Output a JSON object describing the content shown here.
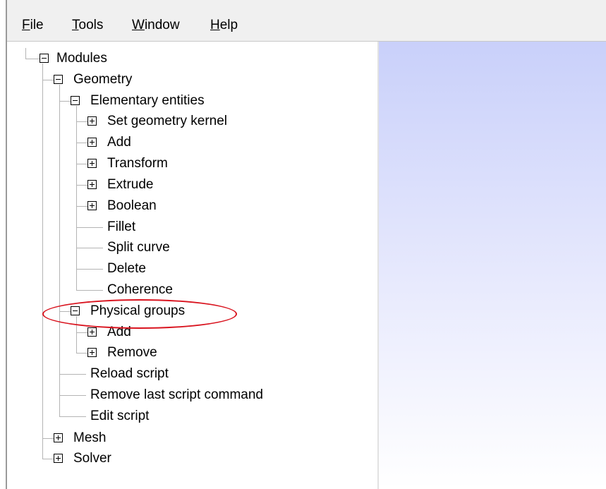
{
  "menubar": {
    "file": {
      "mnemonic": "F",
      "rest": "ile"
    },
    "tools": {
      "mnemonic": "T",
      "rest": "ools"
    },
    "window": {
      "mnemonic": "W",
      "rest": "indow"
    },
    "help": {
      "mnemonic": "H",
      "rest": "elp"
    }
  },
  "tree": {
    "modules": "Modules",
    "geometry": "Geometry",
    "elementary_entities": "Elementary entities",
    "set_geometry_kernel": "Set geometry kernel",
    "add": "Add",
    "transform": "Transform",
    "extrude": "Extrude",
    "boolean": "Boolean",
    "fillet": "Fillet",
    "split_curve": "Split curve",
    "delete": "Delete",
    "coherence": "Coherence",
    "physical_groups": "Physical groups",
    "physical_add": "Add",
    "physical_remove": "Remove",
    "reload_script": "Reload script",
    "remove_last_script_command": "Remove last script command",
    "edit_script": "Edit script",
    "mesh": "Mesh",
    "solver": "Solver"
  },
  "colors": {
    "highlight_ellipse": "#d9141f",
    "graphics_gradient_top": "#c9d0fa"
  }
}
